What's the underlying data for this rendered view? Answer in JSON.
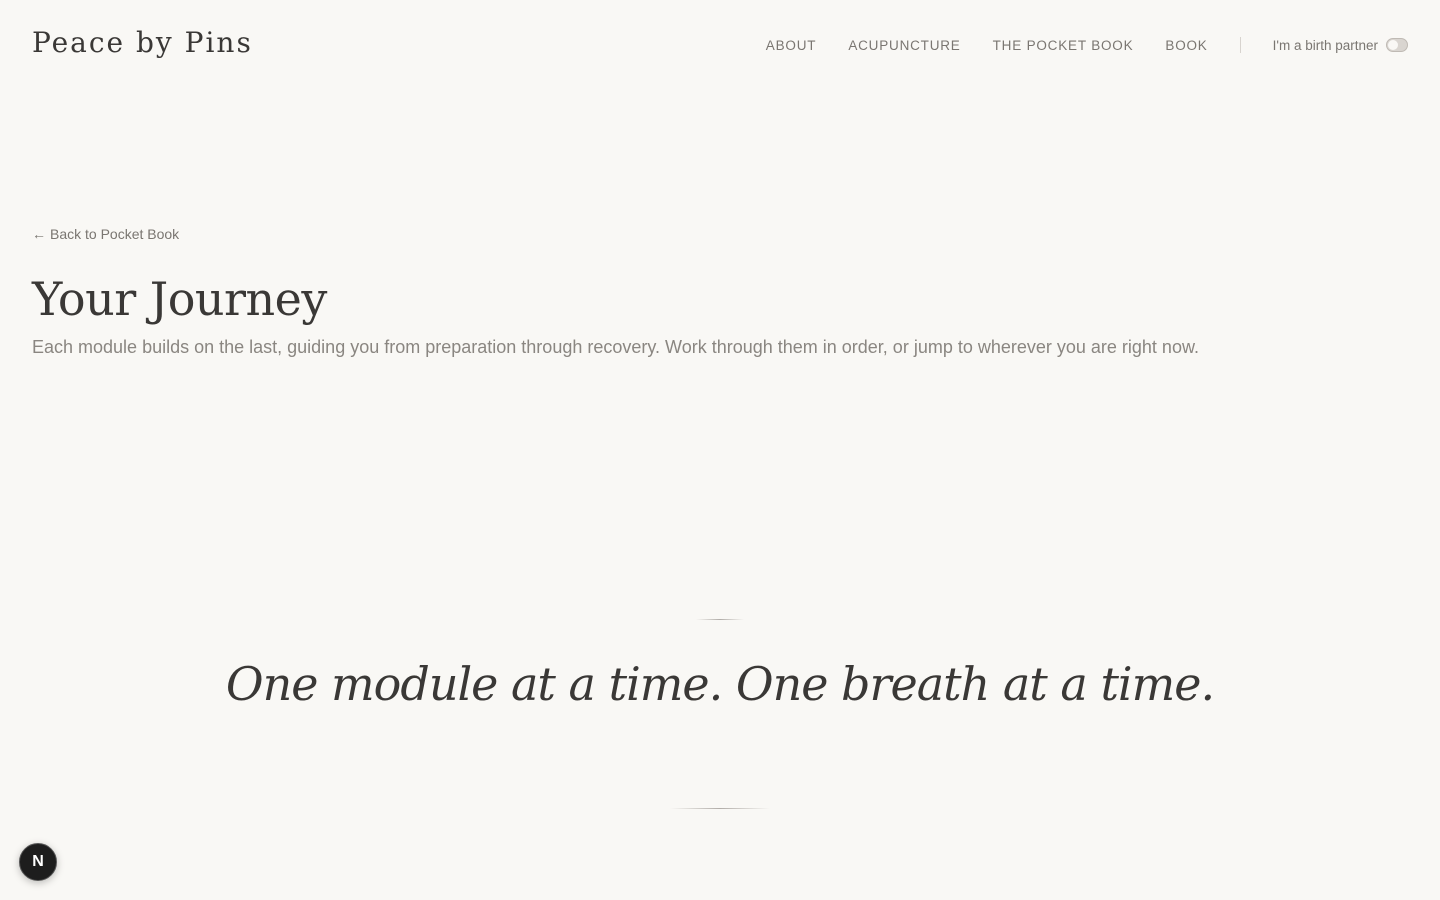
{
  "header": {
    "logo": "Peace by Pins",
    "nav": {
      "about": "ABOUT",
      "acupuncture": "ACUPUNCTURE",
      "pocket_book": "THE POCKET BOOK",
      "book": "BOOK"
    },
    "partner_toggle": {
      "label": "I'm a birth partner",
      "checked": false
    }
  },
  "main": {
    "back_link": {
      "arrow": "←",
      "label": "Back to Pocket Book"
    },
    "title": "Your Journey",
    "intro": "Each module builds on the last, guiding you from preparation through recovery. Work through them in order, or jump to wherever you are right now."
  },
  "quote": {
    "text": "One module at a time. One breath at a time."
  },
  "dev_badge": {
    "letter": "N"
  },
  "colors": {
    "background": "#f9f8f5",
    "heading": "#3a3836",
    "muted": "#7a7671",
    "badge": "#1d1d1d"
  }
}
